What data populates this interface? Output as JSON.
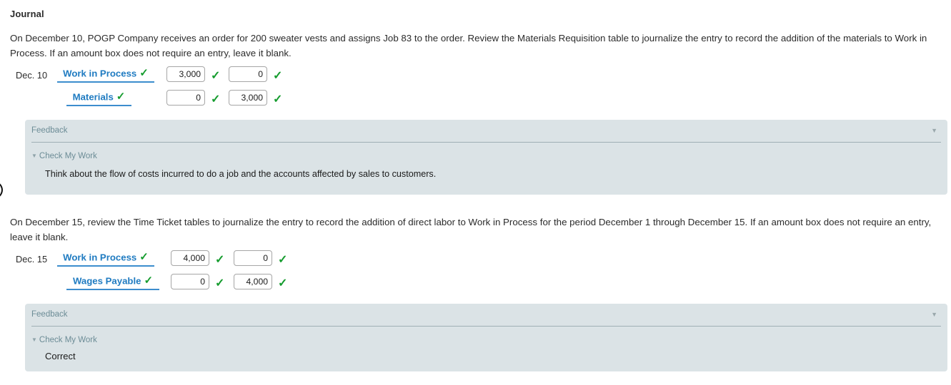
{
  "title": "Journal",
  "edge_marker": "circle-cursor",
  "sections": [
    {
      "prompt": "On December 10, POGP Company receives an order for 200 sweater vests and assigns Job 83 to the order. Review the Materials Requisition table to journalize the entry to record the addition of the materials to Work in Process. If an amount box does not require an entry, leave it blank.",
      "date": "Dec. 10",
      "rows": [
        {
          "account": "Work in Process",
          "account_check": "✓",
          "debit": "3,000",
          "debit_check": "✓",
          "credit": "0",
          "credit_check": "✓"
        },
        {
          "account": "Materials",
          "account_check": "✓",
          "debit": "0",
          "debit_check": "✓",
          "credit": "3,000",
          "credit_check": "✓"
        }
      ],
      "feedback": {
        "label": "Feedback",
        "collapse_icon": "▼",
        "check_my_work": "Check My Work",
        "caret": "▼",
        "body": "Think about the flow of costs incurred to do a job and the accounts affected by sales to customers."
      }
    },
    {
      "prompt": "On December 15, review the Time Ticket tables to journalize the entry to record the addition of direct labor to Work in Process for the period December 1 through December 15. If an amount box does not require an entry, leave it blank.",
      "date": "Dec. 15",
      "rows": [
        {
          "account": "Work in Process",
          "account_check": "✓",
          "debit": "4,000",
          "debit_check": "✓",
          "credit": "0",
          "credit_check": "✓"
        },
        {
          "account": "Wages Payable",
          "account_check": "✓",
          "debit": "0",
          "debit_check": "✓",
          "credit": "4,000",
          "credit_check": "✓"
        }
      ],
      "feedback": {
        "label": "Feedback",
        "collapse_icon": "▼",
        "check_my_work": "Check My Work",
        "caret": "▼",
        "body": "Correct"
      }
    }
  ],
  "colors": {
    "account_link": "#1f7bc1",
    "check_green": "#159c2e",
    "feedback_bg": "#dbe3e6",
    "feedback_text": "#6c8c96"
  }
}
